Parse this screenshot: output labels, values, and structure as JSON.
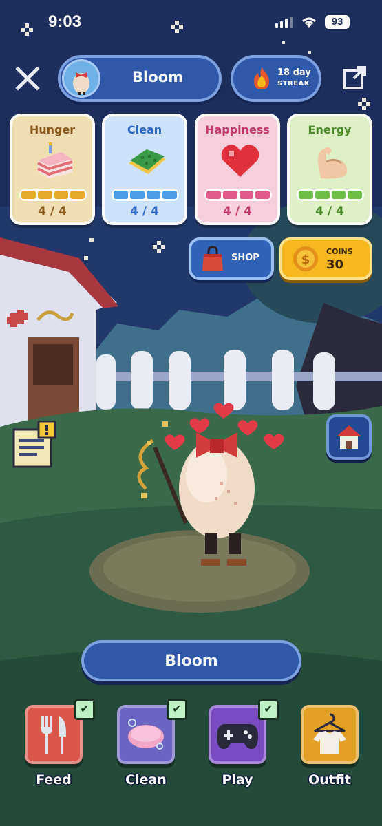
{
  "status_bar": {
    "time": "9:03",
    "battery": "93"
  },
  "header": {
    "pet_name": "Bloom",
    "streak_days": "18 day",
    "streak_label": "STREAK"
  },
  "stats": [
    {
      "title": "Hunger",
      "value": "4 / 4",
      "level": 1.0,
      "icon": "cake-icon"
    },
    {
      "title": "Clean",
      "value": "4 / 4",
      "level": 1.0,
      "icon": "sponge-icon"
    },
    {
      "title": "Happiness",
      "value": "4 / 4",
      "level": 1.0,
      "icon": "heart-icon"
    },
    {
      "title": "Energy",
      "value": "4 / 4",
      "level": 1.0,
      "icon": "muscle-icon"
    }
  ],
  "shop": {
    "label": "SHOP"
  },
  "coins": {
    "label": "COINS",
    "value": "30"
  },
  "pet_plate": {
    "name": "Bloom"
  },
  "actions": [
    {
      "label": "Feed",
      "done": true,
      "icon": "fork-knife-icon"
    },
    {
      "label": "Clean",
      "done": true,
      "icon": "soap-icon"
    },
    {
      "label": "Play",
      "done": true,
      "icon": "gamepad-icon"
    },
    {
      "label": "Outfit",
      "done": false,
      "icon": "shirt-hanger-icon"
    }
  ],
  "colors": {
    "sky": "#1c2c58",
    "pill_blue": "#2f58a8",
    "coin_gold": "#f6b81f",
    "check_green": "#bdf0c5"
  }
}
